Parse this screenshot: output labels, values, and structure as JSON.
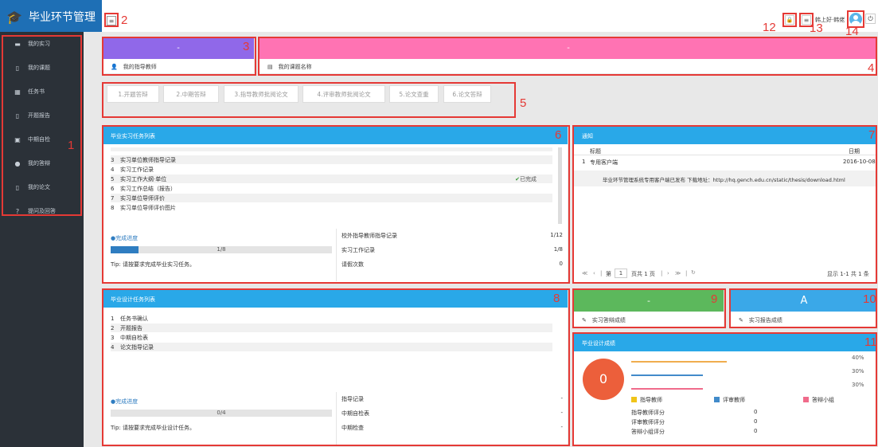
{
  "app": {
    "title": "毕业环节管理"
  },
  "topbar": {
    "user": "韩上好·韩佬"
  },
  "sidebar": {
    "items": [
      {
        "label": "我的实习",
        "icon": "briefcase-icon"
      },
      {
        "label": "我的课题",
        "icon": "document-icon"
      },
      {
        "label": "任务书",
        "icon": "list-icon"
      },
      {
        "label": "开题报告",
        "icon": "report-icon"
      },
      {
        "label": "中期自检",
        "icon": "calendar-icon"
      },
      {
        "label": "我的答辩",
        "icon": "microphone-icon"
      },
      {
        "label": "我的论文",
        "icon": "paper-icon"
      },
      {
        "label": "提问及回答",
        "icon": "question-icon"
      }
    ]
  },
  "cards": {
    "teacher": {
      "value": "-",
      "label": "我的指导教师",
      "color": "#9068e9"
    },
    "topic": {
      "value": "-",
      "label": "我的课题名称",
      "color": "#ff73b3"
    },
    "defense": {
      "value": "-",
      "label": "实习答辩成绩",
      "color": "#5cb85c"
    },
    "report": {
      "value": "A",
      "label": "实习报告成绩",
      "color": "#3aa8e8"
    }
  },
  "steps": [
    "1.开题答辩",
    "2.中期答辩",
    "3.指导教师批阅论文",
    "4.评审教师批阅论文",
    "5.论文查重",
    "6.论文答辩"
  ],
  "internship": {
    "title": "毕业实习任务列表",
    "items": [
      {
        "n": "3",
        "label": "实习单位教师指导记录",
        "status": ""
      },
      {
        "n": "4",
        "label": "实习工作记录",
        "status": ""
      },
      {
        "n": "5",
        "label": "实习工作大纲·单位",
        "status": "已完成"
      },
      {
        "n": "6",
        "label": "实习工作总结（报告）",
        "status": ""
      },
      {
        "n": "7",
        "label": "实习单位导师评价",
        "status": ""
      },
      {
        "n": "8",
        "label": "实习单位导师评价图片",
        "status": ""
      }
    ],
    "progress_title": "完成进度",
    "progress_text": "1/8",
    "progress": 0.125,
    "tip": "Tip: 请按要求完成毕业实习任务。",
    "stats": [
      {
        "label": "校外指导教师指导记录",
        "value": "1/12"
      },
      {
        "label": "实习工作记录",
        "value": "1/8"
      },
      {
        "label": "请假次数",
        "value": "0"
      }
    ]
  },
  "notice": {
    "title": "通知",
    "col_title": "标题",
    "col_date": "日期",
    "row": {
      "n": "1",
      "title": "专用客户端",
      "date": "2016-10-08"
    },
    "detail": "毕业环节管理系统专用客户端已发布 下载地址：http://hq.gench.edu.cn/static/thesis/download.html",
    "pager": {
      "page_prefix": "第",
      "page": "1",
      "page_suffix": "页共 1 页",
      "summary": "显示 1-1 共 1 条"
    }
  },
  "design": {
    "title": "毕业设计任务列表",
    "items": [
      {
        "n": "1",
        "label": "任务书确认"
      },
      {
        "n": "2",
        "label": "开题报告"
      },
      {
        "n": "3",
        "label": "中期自检表"
      },
      {
        "n": "4",
        "label": "论文指导记录"
      }
    ],
    "progress_title": "完成进度",
    "progress_text": "0/4",
    "progress": 0,
    "tip": "Tip: 请按要求完成毕业设计任务。",
    "stats": [
      {
        "label": "指导记录",
        "value": "-"
      },
      {
        "label": "中期自检表",
        "value": "-"
      },
      {
        "label": "中期检查",
        "value": "-"
      }
    ]
  },
  "grades": {
    "title": "毕业设计成绩",
    "total": "0",
    "bars": [
      {
        "pct": "40%",
        "fraction": 0.4,
        "color": "#f0ad4e"
      },
      {
        "pct": "30%",
        "fraction": 0.3,
        "color": "#428bca"
      },
      {
        "pct": "30%",
        "fraction": 0.3,
        "color": "#f06b8b"
      }
    ],
    "legend": [
      {
        "label": "指导教师",
        "color": "#f0c419"
      },
      {
        "label": "评审教师",
        "color": "#428bca"
      },
      {
        "label": "答辩小组",
        "color": "#f06b8b"
      }
    ],
    "scores": [
      {
        "label": "指导教师评分",
        "value": "0"
      },
      {
        "label": "评审教师评分",
        "value": "0"
      },
      {
        "label": "答辩小组评分",
        "value": "0"
      }
    ]
  },
  "annotations": [
    "1",
    "2",
    "3",
    "4",
    "5",
    "6",
    "7",
    "8",
    "9",
    "10",
    "11",
    "12",
    "13",
    "14"
  ]
}
